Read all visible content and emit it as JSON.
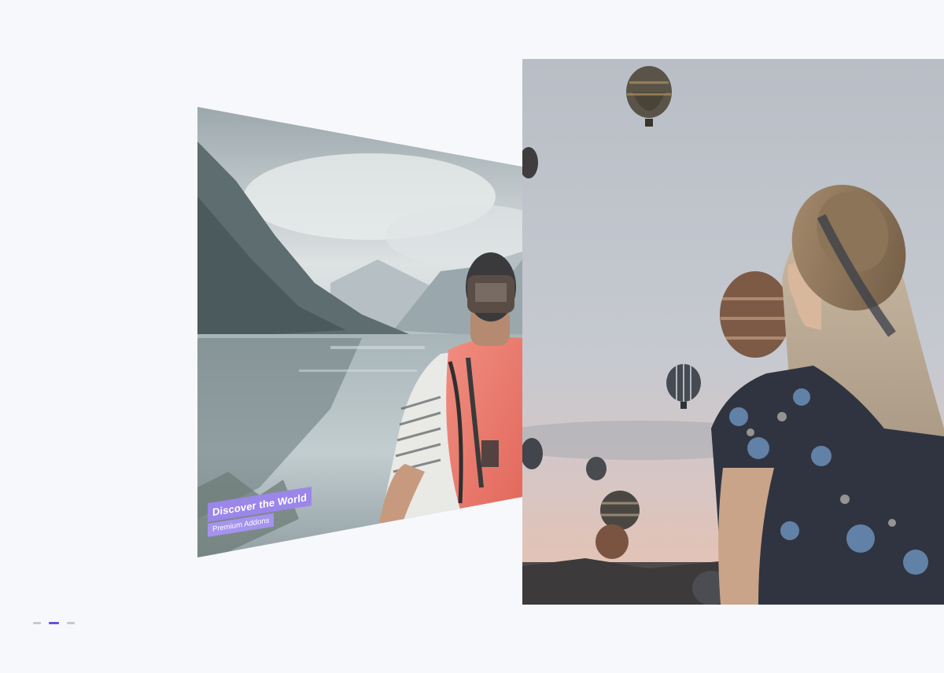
{
  "slides": [
    {
      "caption_title": "Discover the World",
      "caption_subtitle": "Premium Addons"
    },
    {
      "caption_title": "",
      "caption_subtitle": ""
    }
  ],
  "pager": {
    "count": 3,
    "active_index": 1
  },
  "colors": {
    "background": "#f7f8fc",
    "accent": "#6c4fe0",
    "caption_bg": "#9b86ea",
    "pager_inactive": "#c7c7cf"
  }
}
